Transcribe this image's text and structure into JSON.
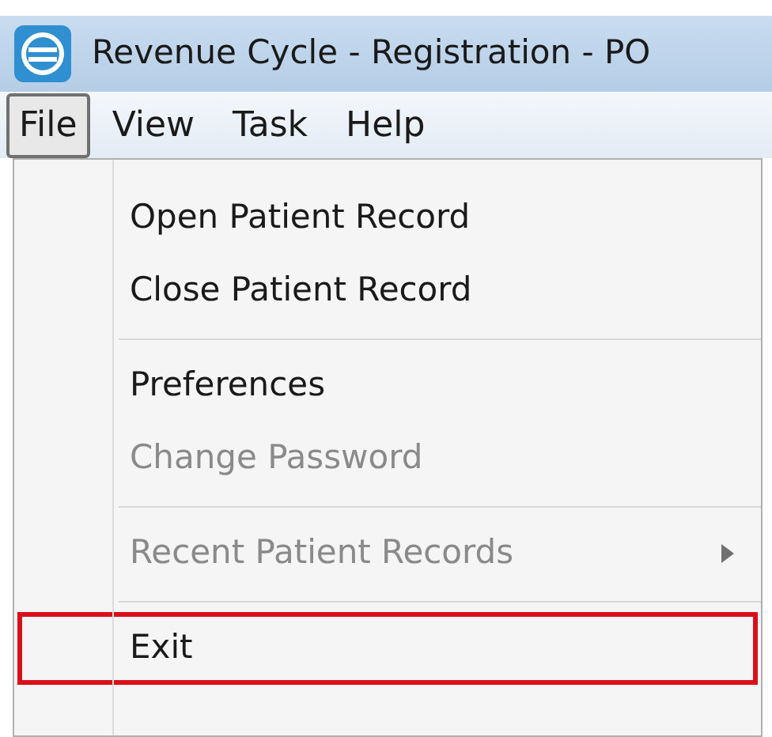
{
  "window": {
    "title": "Revenue Cycle - Registration - PO"
  },
  "menu_bar": [
    {
      "label": "File",
      "selected": true
    },
    {
      "label": "View",
      "selected": false
    },
    {
      "label": "Task",
      "selected": false
    },
    {
      "label": "Help",
      "selected": false
    }
  ],
  "menu": [
    {
      "kind": "item",
      "label": "Open Patient Record",
      "disabled": false,
      "submenu": false,
      "highlighted": false
    },
    {
      "kind": "item",
      "label": "Close Patient Record",
      "disabled": false,
      "submenu": false,
      "highlighted": false
    },
    {
      "kind": "separator"
    },
    {
      "kind": "item",
      "label": "Preferences",
      "disabled": false,
      "submenu": false,
      "highlighted": false
    },
    {
      "kind": "item",
      "label": "Change Password",
      "disabled": true,
      "submenu": false,
      "highlighted": false
    },
    {
      "kind": "separator"
    },
    {
      "kind": "item",
      "label": "Recent Patient Records",
      "disabled": true,
      "submenu": true,
      "highlighted": false
    },
    {
      "kind": "separator"
    },
    {
      "kind": "item",
      "label": "Exit",
      "disabled": false,
      "submenu": false,
      "highlighted": true
    }
  ]
}
